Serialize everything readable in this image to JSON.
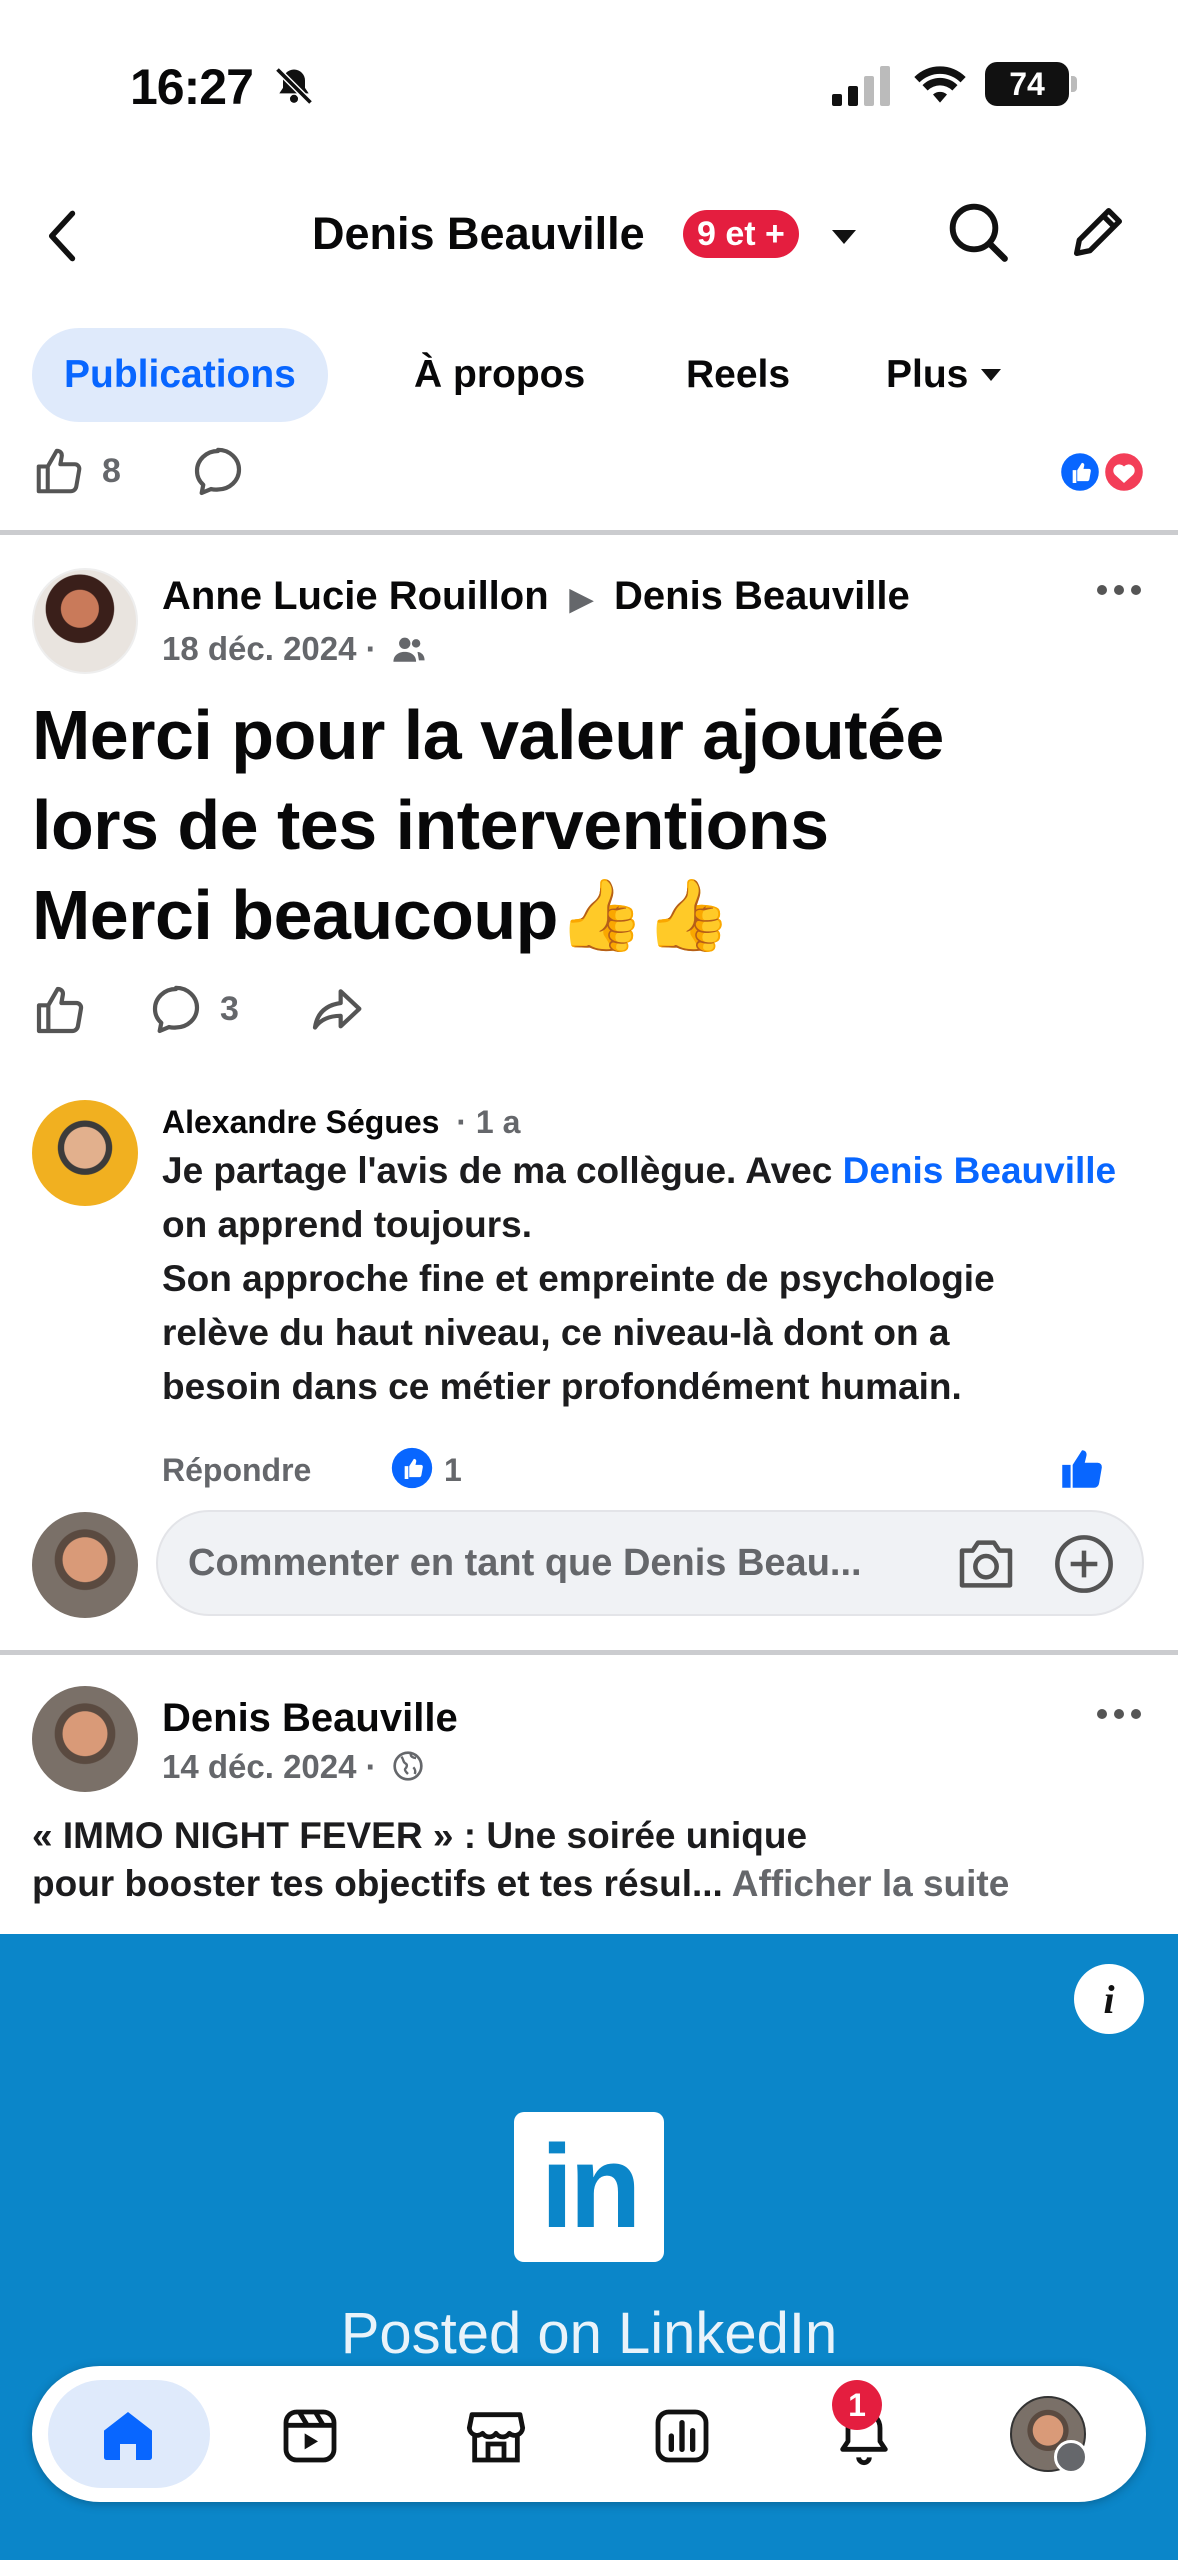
{
  "status_bar": {
    "time": "16:27",
    "battery": "74"
  },
  "header": {
    "title": "Denis Beauville",
    "badge": "9 et +"
  },
  "tabs": [
    {
      "label": "Publications",
      "active": true
    },
    {
      "label": "À propos",
      "active": false
    },
    {
      "label": "Reels",
      "active": false
    },
    {
      "label": "Plus",
      "active": false
    }
  ],
  "prev_post": {
    "like_count": "8"
  },
  "post1": {
    "author": "Anne Lucie Rouillon",
    "target": "Denis Beauville",
    "date": "18 déc. 2024 ·",
    "line1": "Merci pour la valeur ajoutée",
    "line2": "lors de tes interventions",
    "line3": "Merci beaucoup👍👍",
    "comment_count": "3"
  },
  "comment": {
    "author": "Alexandre Ségues",
    "age": "· 1 a",
    "text_before_link": "Je partage l'avis de ma collègue. Avec ",
    "link_text": "Denis Beauville",
    "text_after_link": " on apprend toujours.",
    "line3": "Son approche fine et empreinte de psychologie",
    "line4": "relève du haut niveau, ce niveau-là dont on a",
    "line5": "besoin dans ce métier profondément humain.",
    "reply_label": "Répondre",
    "like_count": "1"
  },
  "comment_input": {
    "placeholder": "Commenter en tant que Denis Beau..."
  },
  "post2": {
    "author": "Denis Beauville",
    "date": "14 déc. 2024 ·",
    "text_line1": "« IMMO NIGHT FEVER » : Une soirée unique",
    "text_line2": "pour booster tes objectifs et tes résul...",
    "more_label": "Afficher la suite",
    "linkedin_logo": "in",
    "linkedin_caption": "Posted on LinkedIn"
  },
  "bottom_nav": {
    "notification_count": "1",
    "items": [
      "home-icon",
      "reels-icon",
      "marketplace-icon",
      "dashboard-icon",
      "bell-icon",
      "profile-avatar"
    ]
  },
  "colors": {
    "accent": "#0866ff",
    "badge_red": "#e41e3f",
    "linkedin_blue": "#0b86c9"
  }
}
